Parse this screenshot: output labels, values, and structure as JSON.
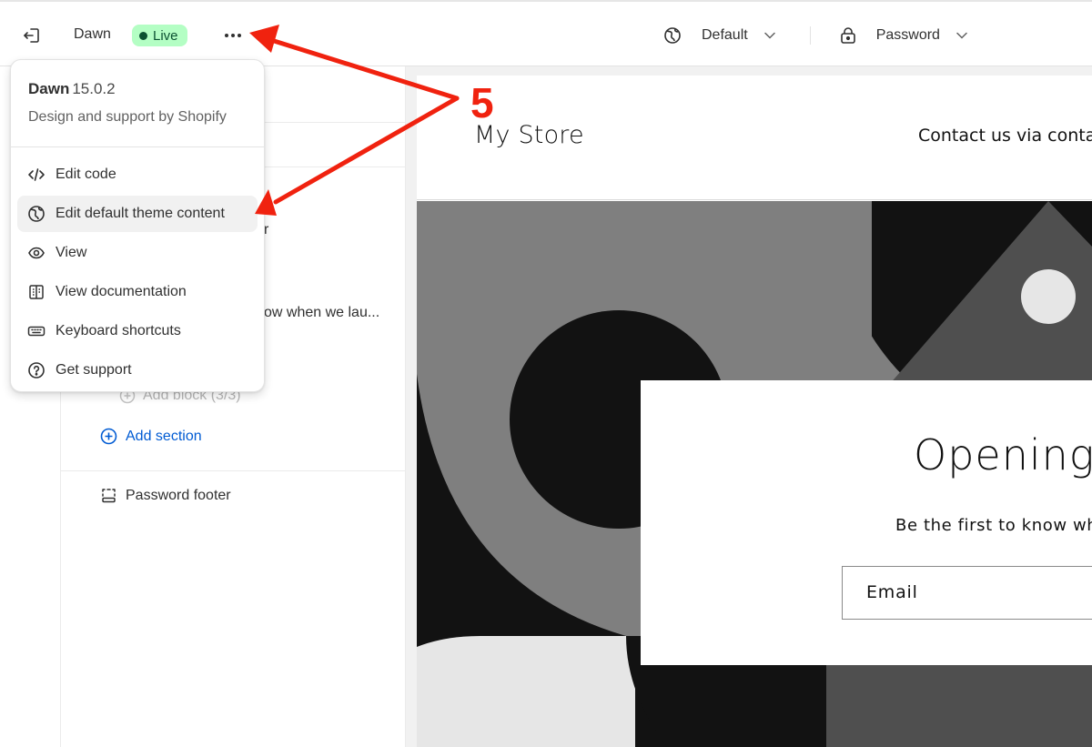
{
  "topbar": {
    "exit_icon": "exit-icon",
    "theme_name": "Dawn",
    "status_badge": "Live",
    "more_icon": "ellipsis-icon",
    "language": {
      "icon": "globe-icon",
      "label": "Default"
    },
    "template": {
      "icon": "lock-icon",
      "label": "Password"
    }
  },
  "sidebar": {
    "partial_text_1": "r",
    "partial_text_2": "ow when we lau...",
    "add_block": "Add block (3/3)",
    "add_section": "Add section",
    "password_footer": "Password footer"
  },
  "popover": {
    "theme_name": "Dawn",
    "version": "15.0.2",
    "description": "Design and support by Shopify",
    "items": [
      {
        "icon": "code-icon",
        "label": "Edit code",
        "active": false
      },
      {
        "icon": "globe-icon",
        "label": "Edit default theme content",
        "active": true
      },
      {
        "icon": "eye-icon",
        "label": "View",
        "active": false
      },
      {
        "icon": "book-icon",
        "label": "View documentation",
        "active": false
      },
      {
        "icon": "keyboard-icon",
        "label": "Keyboard shortcuts",
        "active": false
      },
      {
        "icon": "question-icon",
        "label": "Get support",
        "active": false
      }
    ]
  },
  "preview": {
    "store_name": "My Store",
    "contact_text": "Contact us via contac",
    "hero_title": "Opening s",
    "hero_subtitle": "Be the first to know whe",
    "email_placeholder": "Email"
  },
  "annotation": {
    "step_number": "5",
    "color": "#f0220f"
  },
  "colors": {
    "live_badge_bg": "#b4fec4",
    "live_badge_text": "#0c5132",
    "link_blue": "#005bd3",
    "menu_active_bg": "#f1f1f1"
  }
}
